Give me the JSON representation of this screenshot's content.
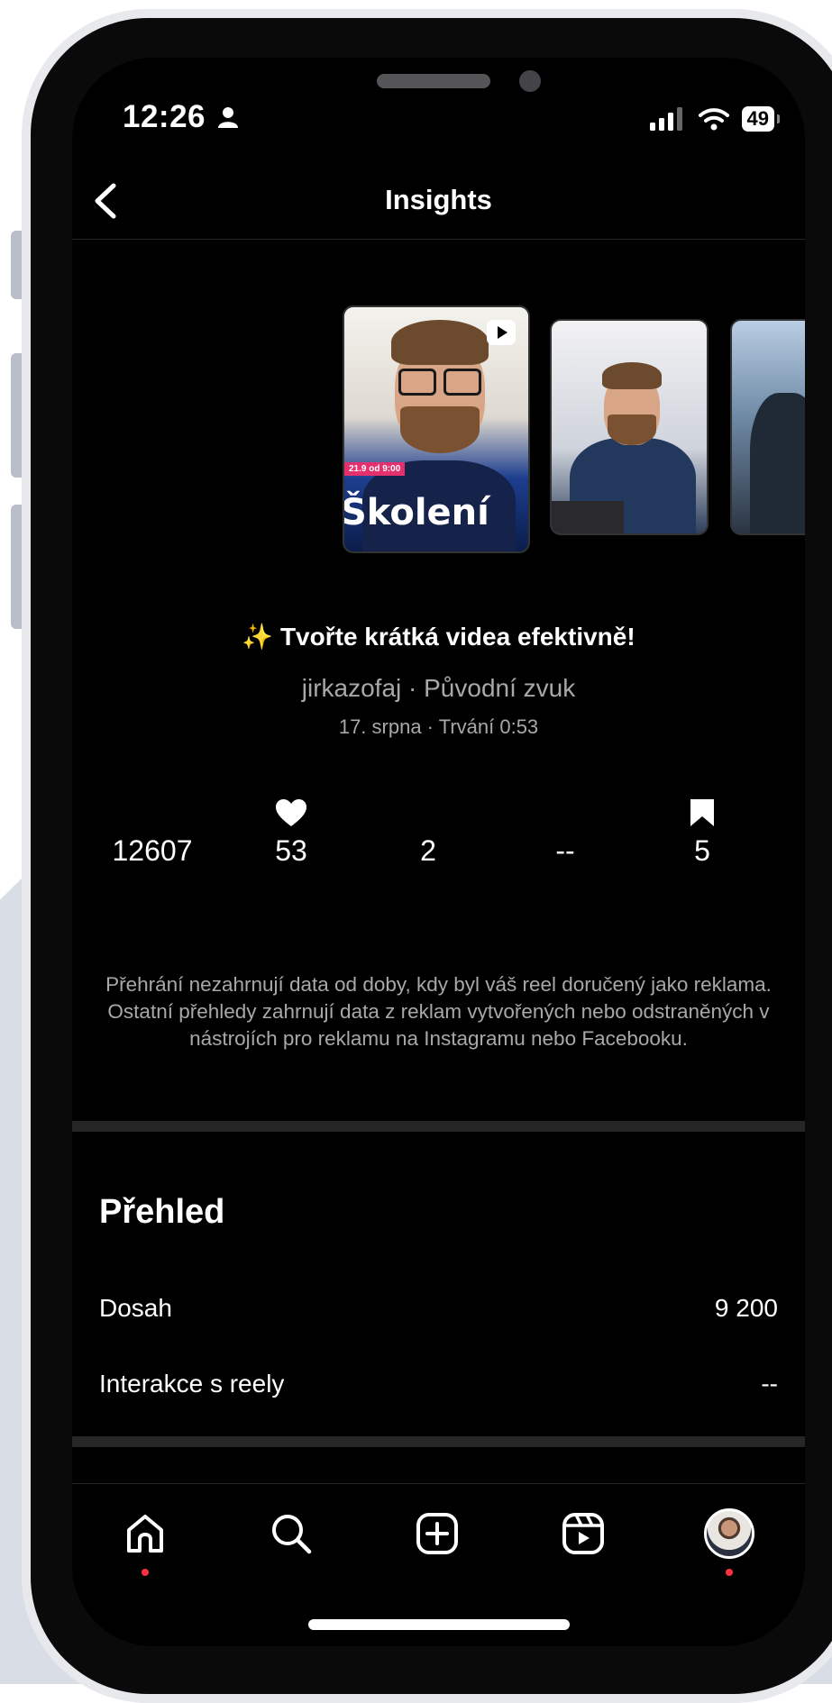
{
  "status_bar": {
    "time": "12:26",
    "battery": "49"
  },
  "header": {
    "title": "Insights"
  },
  "reel": {
    "thumbnail_text": "Školení",
    "thumbnail_tag": "21.9 od 9:00",
    "caption": "✨ Tvořte krátká videa efektivně!",
    "author_audio": "jirkazofaj · Původní zvuk",
    "date_duration": "17. srpna · Trvání 0:53"
  },
  "stats": [
    {
      "icon": "none",
      "value": "12607"
    },
    {
      "icon": "heart-icon",
      "value": "53"
    },
    {
      "icon": "none",
      "value": "2"
    },
    {
      "icon": "none",
      "value": "--"
    },
    {
      "icon": "bookmark-icon",
      "value": "5"
    }
  ],
  "disclaimer": "Přehrání nezahrnují data od doby, kdy byl váš reel doručený jako reklama. Ostatní přehledy zahrnují data z reklam vytvořených nebo odstraněných v nástrojích pro reklamu na Instagramu nebo Facebooku.",
  "overview": {
    "title": "Přehled",
    "rows": [
      {
        "label": "Dosah",
        "value": "9 200"
      },
      {
        "label": "Interakce s reely",
        "value": "--"
      }
    ]
  },
  "tabbar": {
    "items": [
      "home-icon",
      "search-icon",
      "create-icon",
      "reels-icon",
      "profile-avatar"
    ]
  },
  "colors": {
    "background": "#000000",
    "text_primary": "#ffffff",
    "text_secondary": "#a8a8a8",
    "divider": "#262626",
    "notification_dot": "#ff3040"
  }
}
